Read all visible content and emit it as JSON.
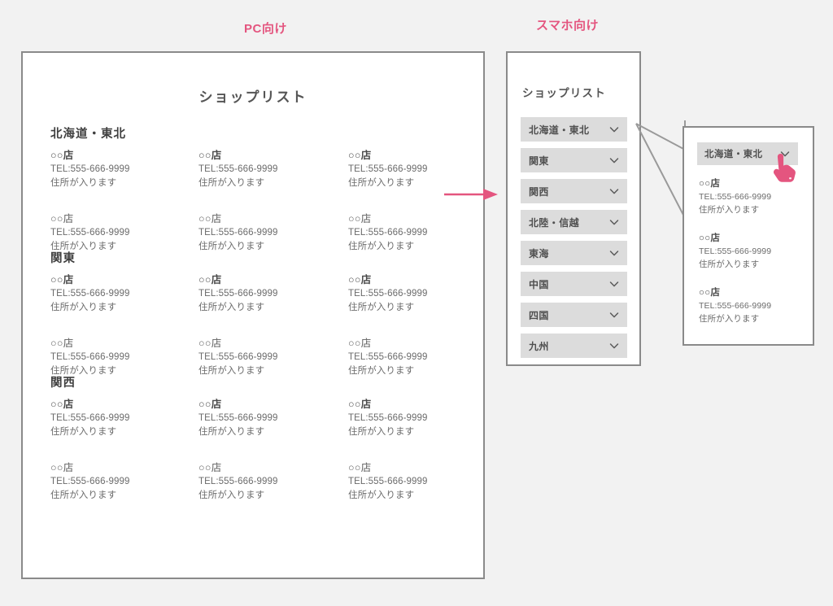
{
  "captions": {
    "pc": "PC向け",
    "smartphone": "スマホ向け"
  },
  "colors": {
    "accent_pink": "#e4557f",
    "page_background": "#f2f2f2",
    "panel_border": "#8a8a8a",
    "accordion_background": "#dcdcdc",
    "text": "#4a4a4a"
  },
  "pc_panel": {
    "title": "ショップリスト",
    "regions": [
      {
        "name": "北海道・東北",
        "rows": [
          [
            {
              "name": "○○店",
              "tel": "TEL:555-666-9999",
              "address": "住所が入ります",
              "bold": true
            },
            {
              "name": "○○店",
              "tel": "TEL:555-666-9999",
              "address": "住所が入ります",
              "bold": true
            },
            {
              "name": "○○店",
              "tel": "TEL:555-666-9999",
              "address": "住所が入ります",
              "bold": true
            }
          ],
          [
            {
              "name": "○○店",
              "tel": "TEL:555-666-9999",
              "address": "住所が入ります",
              "bold": false
            },
            {
              "name": "○○店",
              "tel": "TEL:555-666-9999",
              "address": "住所が入ります",
              "bold": false
            },
            {
              "name": "○○店",
              "tel": "TEL:555-666-9999",
              "address": "住所が入ります",
              "bold": false
            }
          ]
        ]
      },
      {
        "name": "関東",
        "rows": [
          [
            {
              "name": "○○店",
              "tel": "TEL:555-666-9999",
              "address": "住所が入ります",
              "bold": true
            },
            {
              "name": "○○店",
              "tel": "TEL:555-666-9999",
              "address": "住所が入ります",
              "bold": true
            },
            {
              "name": "○○店",
              "tel": "TEL:555-666-9999",
              "address": "住所が入ります",
              "bold": true
            }
          ],
          [
            {
              "name": "○○店",
              "tel": "TEL:555-666-9999",
              "address": "住所が入ります",
              "bold": false
            },
            {
              "name": "○○店",
              "tel": "TEL:555-666-9999",
              "address": "住所が入ります",
              "bold": false
            },
            {
              "name": "○○店",
              "tel": "TEL:555-666-9999",
              "address": "住所が入ります",
              "bold": false
            }
          ]
        ]
      },
      {
        "name": "関西",
        "rows": [
          [
            {
              "name": "○○店",
              "tel": "TEL:555-666-9999",
              "address": "住所が入ります",
              "bold": true
            },
            {
              "name": "○○店",
              "tel": "TEL:555-666-9999",
              "address": "住所が入ります",
              "bold": true
            },
            {
              "name": "○○店",
              "tel": "TEL:555-666-9999",
              "address": "住所が入ります",
              "bold": true
            }
          ],
          [
            {
              "name": "○○店",
              "tel": "TEL:555-666-9999",
              "address": "住所が入ります",
              "bold": false
            },
            {
              "name": "○○店",
              "tel": "TEL:555-666-9999",
              "address": "住所が入ります",
              "bold": false
            },
            {
              "name": "○○店",
              "tel": "TEL:555-666-9999",
              "address": "住所が入ります",
              "bold": false
            }
          ]
        ]
      }
    ]
  },
  "sp_panel": {
    "title": "ショップリスト",
    "accordion": [
      {
        "label": "北海道・東北",
        "icon": "chevron-down-icon",
        "expanded": false
      },
      {
        "label": "関東",
        "icon": "chevron-down-icon",
        "expanded": false
      },
      {
        "label": "関西",
        "icon": "chevron-down-icon",
        "expanded": false
      },
      {
        "label": "北陸・信越",
        "icon": "chevron-down-icon",
        "expanded": false
      },
      {
        "label": "東海",
        "icon": "chevron-down-icon",
        "expanded": false
      },
      {
        "label": "中国",
        "icon": "chevron-down-icon",
        "expanded": false
      },
      {
        "label": "四国",
        "icon": "chevron-down-icon",
        "expanded": false
      },
      {
        "label": "九州",
        "icon": "chevron-down-icon",
        "expanded": false
      }
    ]
  },
  "popup": {
    "header_label": "北海道・東北",
    "header_icon": "chevron-down-icon",
    "cursor_icon": "pointing-hand-icon",
    "shops": [
      {
        "name": "○○店",
        "tel": "TEL:555-666-9999",
        "address": "住所が入ります"
      },
      {
        "name": "○○店",
        "tel": "TEL:555-666-9999",
        "address": "住所が入ります"
      },
      {
        "name": "○○店",
        "tel": "TEL:555-666-9999",
        "address": "住所が入ります"
      }
    ]
  },
  "flow": {
    "arrow_icon": "right-arrow-icon",
    "callout_icon": "callout-lines"
  }
}
